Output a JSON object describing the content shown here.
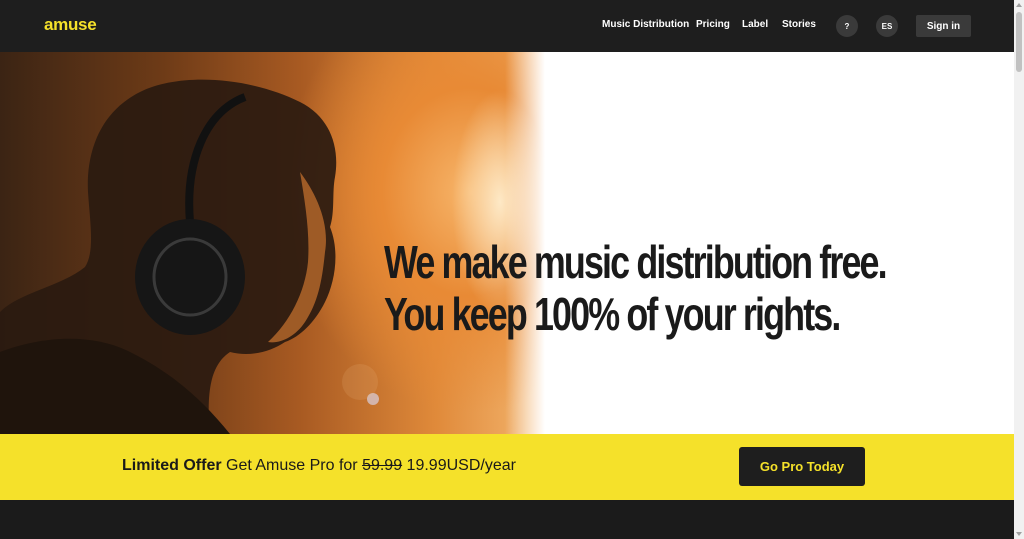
{
  "brand": {
    "logo_text": "amuse",
    "accent": "#f5e12a"
  },
  "nav": {
    "items": [
      "Music Distribution",
      "Pricing",
      "Label",
      "Stories"
    ],
    "help_label": "?",
    "language_label": "ES",
    "signin_label": "Sign in"
  },
  "hero": {
    "line1": "We make music distribution free.",
    "line2": "You keep 100% of your rights."
  },
  "offer": {
    "strong": "Limited Offer",
    "text": " Get Amuse Pro for ",
    "old_price": "59.99",
    "new_price": " 19.99USD/year",
    "cta": "Go Pro Today"
  }
}
